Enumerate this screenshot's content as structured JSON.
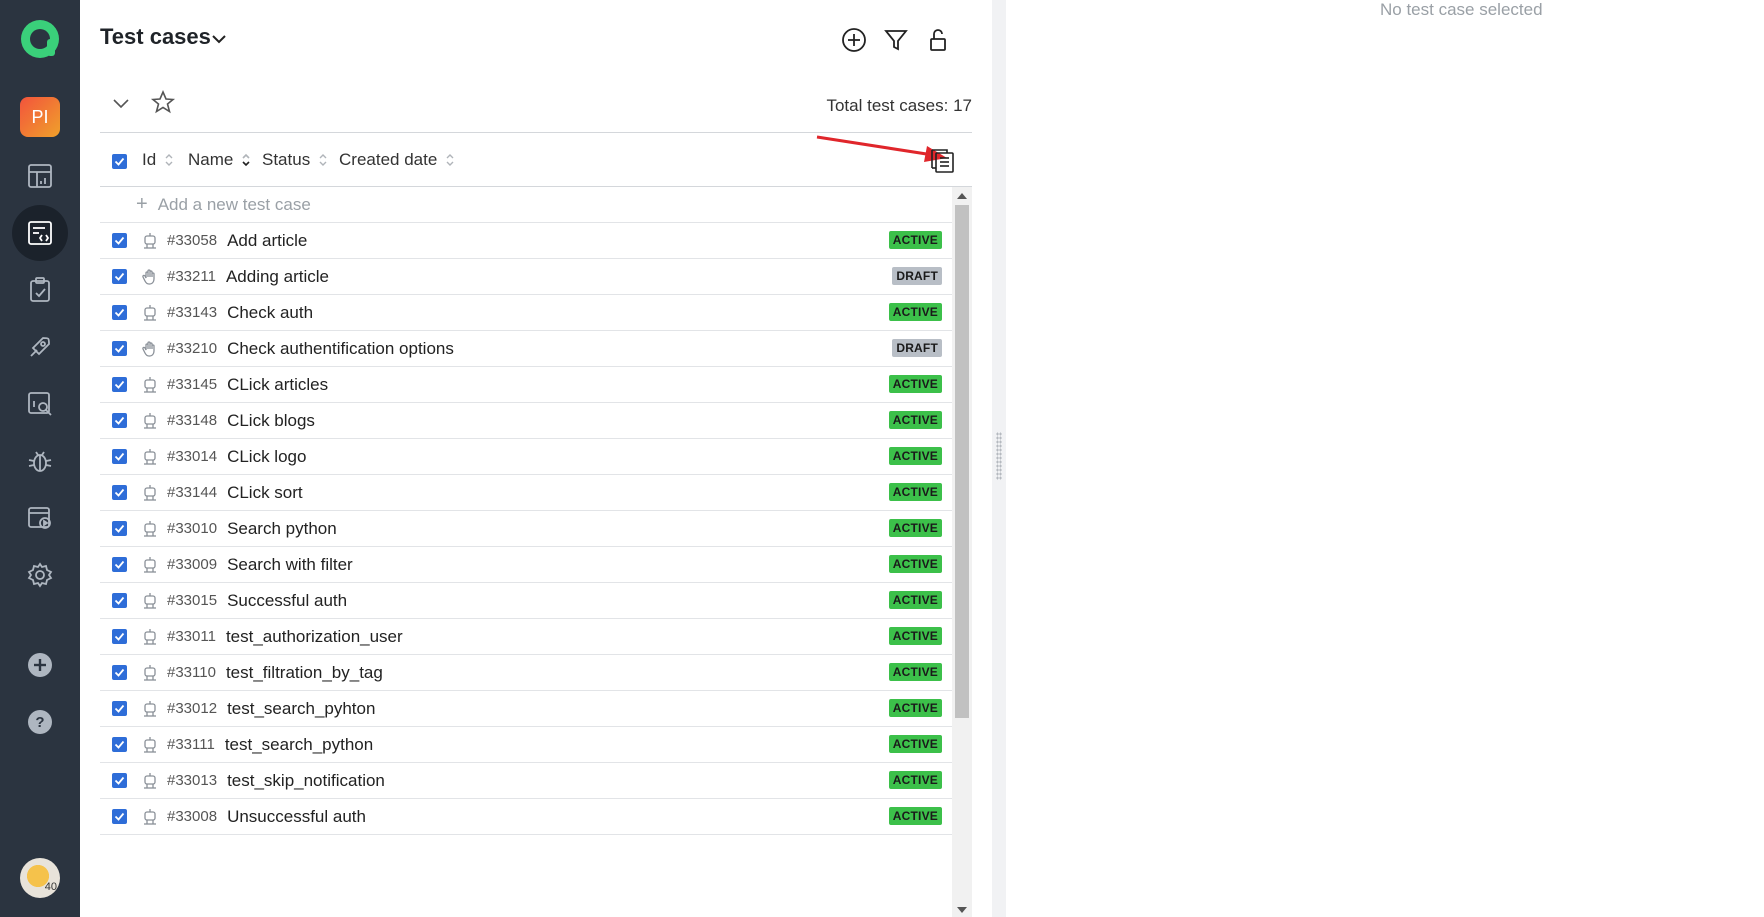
{
  "sidebar": {
    "project_initials": "PI",
    "items": [
      {
        "name": "dashboards-icon",
        "active": false
      },
      {
        "name": "test-cases-icon",
        "active": true
      },
      {
        "name": "test-plans-icon",
        "active": false
      },
      {
        "name": "launches-icon",
        "active": false
      },
      {
        "name": "analytics-icon",
        "active": false
      },
      {
        "name": "defects-icon",
        "active": false
      },
      {
        "name": "jobs-icon",
        "active": false
      },
      {
        "name": "settings-icon",
        "active": false
      }
    ],
    "avatar_badge": "40"
  },
  "header": {
    "title": "Test cases",
    "total_label": "Total test cases: 17"
  },
  "columns": {
    "id": "Id",
    "name": "Name",
    "status": "Status",
    "created": "Created date"
  },
  "add_row_label": "Add a new test case",
  "rows": [
    {
      "id": "#33058",
      "name": "Add article",
      "status": "ACTIVE",
      "type": "automated"
    },
    {
      "id": "#33211",
      "name": "Adding article",
      "status": "DRAFT",
      "type": "manual"
    },
    {
      "id": "#33143",
      "name": "Check auth",
      "status": "ACTIVE",
      "type": "automated"
    },
    {
      "id": "#33210",
      "name": "Check authentification options",
      "status": "DRAFT",
      "type": "manual"
    },
    {
      "id": "#33145",
      "name": "CLick articles",
      "status": "ACTIVE",
      "type": "automated"
    },
    {
      "id": "#33148",
      "name": "CLick blogs",
      "status": "ACTIVE",
      "type": "automated"
    },
    {
      "id": "#33014",
      "name": "CLick logo",
      "status": "ACTIVE",
      "type": "automated"
    },
    {
      "id": "#33144",
      "name": "CLick sort",
      "status": "ACTIVE",
      "type": "automated"
    },
    {
      "id": "#33010",
      "name": "Search python",
      "status": "ACTIVE",
      "type": "automated"
    },
    {
      "id": "#33009",
      "name": "Search with filter",
      "status": "ACTIVE",
      "type": "automated"
    },
    {
      "id": "#33015",
      "name": "Successful auth",
      "status": "ACTIVE",
      "type": "automated"
    },
    {
      "id": "#33011",
      "name": "test_authorization_user",
      "status": "ACTIVE",
      "type": "automated"
    },
    {
      "id": "#33110",
      "name": "test_filtration_by_tag",
      "status": "ACTIVE",
      "type": "automated"
    },
    {
      "id": "#33012",
      "name": "test_search_pyhton",
      "status": "ACTIVE",
      "type": "automated"
    },
    {
      "id": "#33111",
      "name": "test_search_python",
      "status": "ACTIVE",
      "type": "automated"
    },
    {
      "id": "#33013",
      "name": "test_skip_notification",
      "status": "ACTIVE",
      "type": "automated"
    },
    {
      "id": "#33008",
      "name": "Unsuccessful auth",
      "status": "ACTIVE",
      "type": "automated"
    }
  ],
  "detail": {
    "empty_text": "No test case selected"
  },
  "colors": {
    "sidebar_bg": "#2b3440",
    "checkbox": "#2e6dd8",
    "active_badge": "#3cc04a",
    "draft_badge": "#b8bec6",
    "annotation_arrow": "#e0262b"
  }
}
